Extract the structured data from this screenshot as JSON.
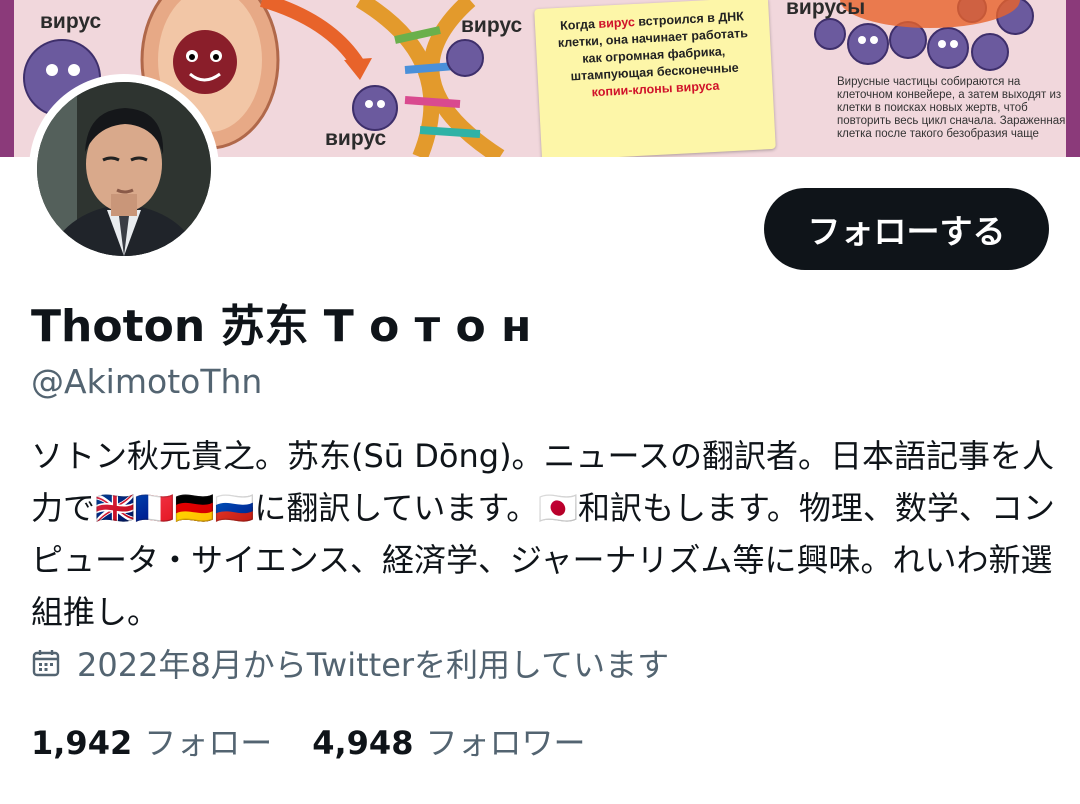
{
  "banner": {
    "labels": [
      "вирус",
      "вирус",
      "вирус",
      "вирусы"
    ],
    "note": {
      "line1_before": "Когда",
      "line1_red": "вирус",
      "line1_after": "встроился в ДНК",
      "line2": "клетки, она начинает работать",
      "line3": "как огромная фабрика,",
      "line4": "штампующая бесконечные",
      "line5_red": "копии-клоны вируса"
    },
    "side_text": "Вирусные частицы собираются на клеточном конвейере, а затем выходят из клетки в поисках новых жертв, чтоб повторить весь цикл сначала. Зараженная клетка после такого безобразия чаще"
  },
  "profile": {
    "display_name": "Thoton 苏东 Т о т о н",
    "handle": "@AkimotoThn",
    "bio": "ソトン秋元貴之。苏东(Sū Dōng)。ニュースの翻訳者。日本語記事を人力で🇬🇧🇫🇷🇩🇪🇷🇺に翻訳しています。🇯🇵和訳もします。物理、数学、コンピュータ・サイエンス、経済学、ジャーナリズム等に興味。れいわ新選組推し。",
    "joined": "2022年8月からTwitterを利用しています",
    "follow_button": "フォローする",
    "following_count": "1,942",
    "following_label": "フォロー",
    "followers_count": "4,948",
    "followers_label": "フォロワー"
  },
  "colors": {
    "text_primary": "#0f1419",
    "text_secondary": "#536471",
    "button_bg": "#0f1419",
    "button_text": "#ffffff",
    "virus_purple": "#6b5a9e",
    "note_red": "#d0122a"
  },
  "icons": {
    "joined": "calendar-icon"
  }
}
